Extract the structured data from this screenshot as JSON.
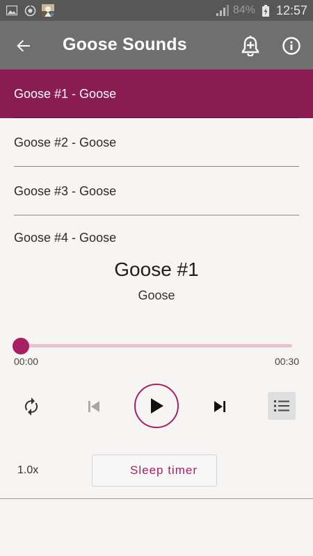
{
  "status_bar": {
    "battery_percent": "84%",
    "time": "12:57",
    "icons": [
      "image-icon",
      "sync-icon",
      "avatar-icon",
      "signal-icon",
      "battery-icon"
    ]
  },
  "app_bar": {
    "title": "Goose Sounds",
    "icons": [
      "back-arrow-icon",
      "add-alarm-icon",
      "info-icon"
    ]
  },
  "sound_list": {
    "items": [
      {
        "label": "Goose #1 - Goose",
        "selected": true
      },
      {
        "label": "Goose #2 - Goose",
        "selected": false
      },
      {
        "label": "Goose #3 - Goose",
        "selected": false
      },
      {
        "label": "Goose #4 - Goose",
        "selected": false
      }
    ]
  },
  "now_playing": {
    "title": "Goose #1",
    "subtitle": "Goose",
    "position": "00:00",
    "duration": "00:30",
    "progress": 0.0
  },
  "controls": {
    "icons": [
      "repeat-icon",
      "previous-icon",
      "play-icon",
      "next-icon",
      "playlist-icon"
    ]
  },
  "bottom": {
    "speed": "1.0x",
    "sleep_timer_label": "Sleep timer"
  },
  "colors": {
    "accent": "#a81f62",
    "selected_row": "#8a1c52",
    "app_bar": "#6f6f6f",
    "status_bar": "#575757"
  }
}
